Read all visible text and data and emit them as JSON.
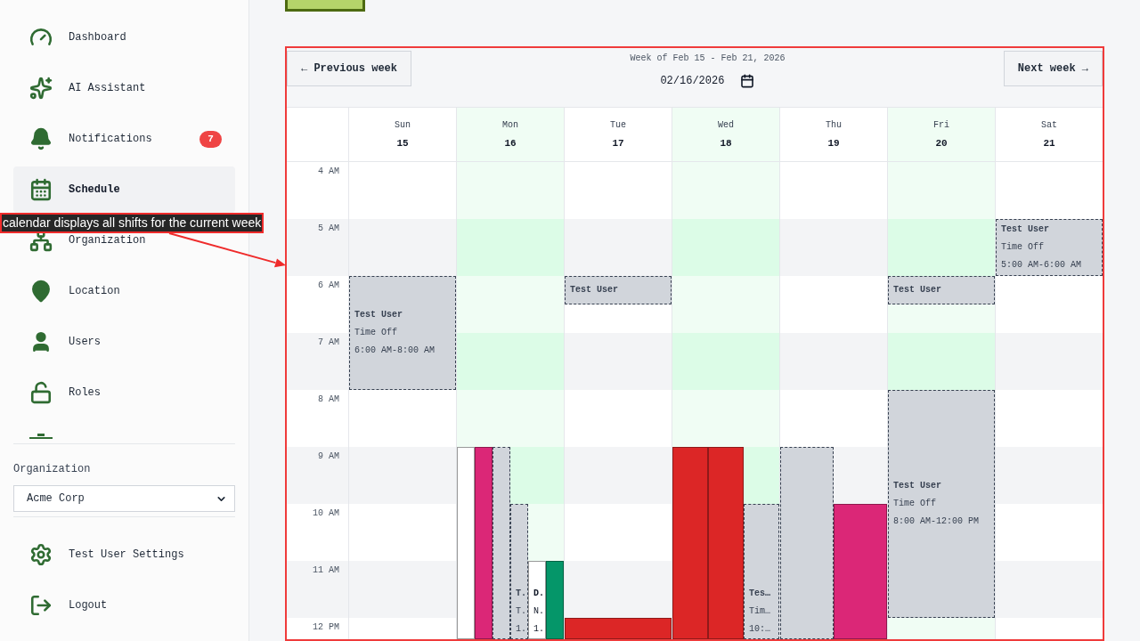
{
  "sidebar": {
    "nav_items": [
      {
        "label": "Dashboard",
        "selected": false
      },
      {
        "label": "AI Assistant",
        "selected": false
      },
      {
        "label": "Notifications",
        "selected": false,
        "badge": "7"
      },
      {
        "label": "Schedule",
        "selected": true
      },
      {
        "label": "Organization",
        "selected": false
      },
      {
        "label": "Location",
        "selected": false
      },
      {
        "label": "Users",
        "selected": false
      },
      {
        "label": "Roles",
        "selected": false
      }
    ],
    "organization": {
      "label": "Organization",
      "value": "Acme Corp"
    },
    "footer_items": [
      {
        "label": "Test User Settings"
      },
      {
        "label": "Logout"
      }
    ]
  },
  "calendar": {
    "previous_button": "← Previous week",
    "title": "Week of Feb 15 - Feb 21, 2026",
    "date_value": "02/16/2026",
    "next_button": "Next week →",
    "hours": [
      "4 AM",
      "5 AM",
      "6 AM",
      "7 AM",
      "8 AM",
      "9 AM",
      "10 AM",
      "11 AM",
      "12 PM"
    ],
    "days": [
      {
        "name": "Sun",
        "date": "15",
        "highlighted": false,
        "events": [
          {
            "kind": "time_off",
            "name": "Test User",
            "type": "Time Off",
            "time": "6:00 AM-8:00 AM"
          }
        ]
      },
      {
        "name": "Mon",
        "date": "16",
        "highlighted": true,
        "events": [
          {
            "kind": "shift",
            "color": "#ffffff"
          },
          {
            "kind": "shift",
            "color": "#db2777"
          },
          {
            "kind": "time_off"
          },
          {
            "kind": "time_off",
            "name": "T.",
            "type": "T.",
            "time": "1."
          },
          {
            "kind": "shift",
            "color": "#ffffff",
            "name": "D.",
            "type": "N.",
            "time": "1."
          },
          {
            "kind": "shift",
            "color": "#059669"
          }
        ]
      },
      {
        "name": "Tue",
        "date": "17",
        "highlighted": false,
        "events": [
          {
            "kind": "time_off",
            "name": "Test User"
          },
          {
            "kind": "shift",
            "color": "#dc2626"
          }
        ]
      },
      {
        "name": "Wed",
        "date": "18",
        "highlighted": true,
        "events": [
          {
            "kind": "shift",
            "color": "#dc2626"
          },
          {
            "kind": "shift",
            "color": "#dc2626"
          },
          {
            "kind": "time_off",
            "name": "Tes…",
            "type": "Tim…",
            "time": "10:…"
          }
        ]
      },
      {
        "name": "Thu",
        "date": "19",
        "highlighted": false,
        "events": [
          {
            "kind": "time_off"
          },
          {
            "kind": "shift",
            "color": "#db2777"
          }
        ]
      },
      {
        "name": "Fri",
        "date": "20",
        "highlighted": true,
        "events": [
          {
            "kind": "time_off",
            "name": "Test User"
          },
          {
            "kind": "time_off",
            "name": "Test User",
            "type": "Time Off",
            "time": "8:00 AM-12:00 PM"
          }
        ]
      },
      {
        "name": "Sat",
        "date": "21",
        "highlighted": false,
        "events": [
          {
            "kind": "time_off",
            "name": "Test User",
            "type": "Time Off",
            "time": "5:00 AM-6:00 AM"
          }
        ]
      }
    ]
  },
  "annotation": {
    "label": "calendar displays all shifts for the current week"
  }
}
